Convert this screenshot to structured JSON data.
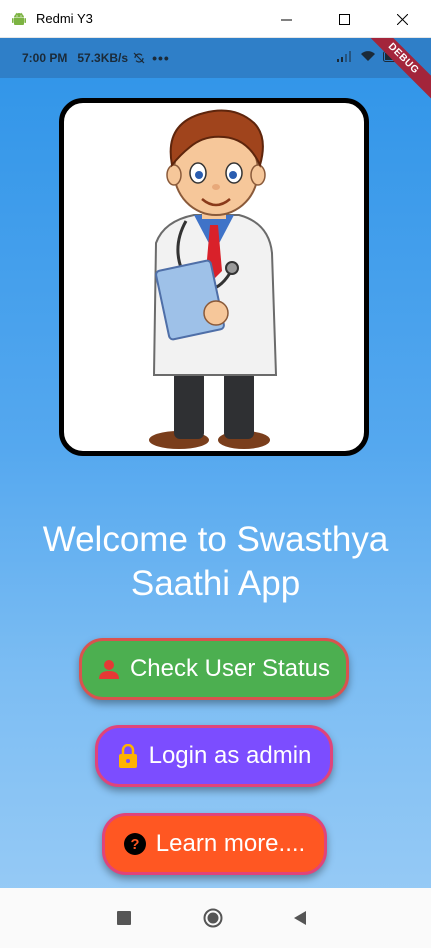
{
  "window": {
    "title": "Redmi Y3",
    "app_icon": "android-icon",
    "controls": [
      "minimize-icon",
      "maximize-icon",
      "close-icon"
    ]
  },
  "statusbar": {
    "time": "7:00 PM",
    "speed": "57.3KB/s",
    "sync_icon": "sync-off-icon",
    "more": "•••",
    "right_icons": [
      "signal-icon",
      "wifi-icon",
      "battery-icon"
    ]
  },
  "debug_banner": "DEBUG",
  "hero": {
    "image": "doctor-illustration"
  },
  "welcome": {
    "line1": "Welcome to Swasthya",
    "line2": "Saathi App"
  },
  "buttons": {
    "check_status": {
      "label": "Check User Status",
      "icon": "person-icon",
      "color": "#4caf50"
    },
    "login_admin": {
      "label": "Login as admin",
      "icon": "lock-icon",
      "color": "#7c4dff"
    },
    "learn_more": {
      "label": "Learn more....",
      "icon": "help-icon",
      "color": "#ff5722"
    }
  },
  "navbar": {
    "buttons": [
      "recents-square-icon",
      "home-circle-icon",
      "back-triangle-icon"
    ]
  }
}
